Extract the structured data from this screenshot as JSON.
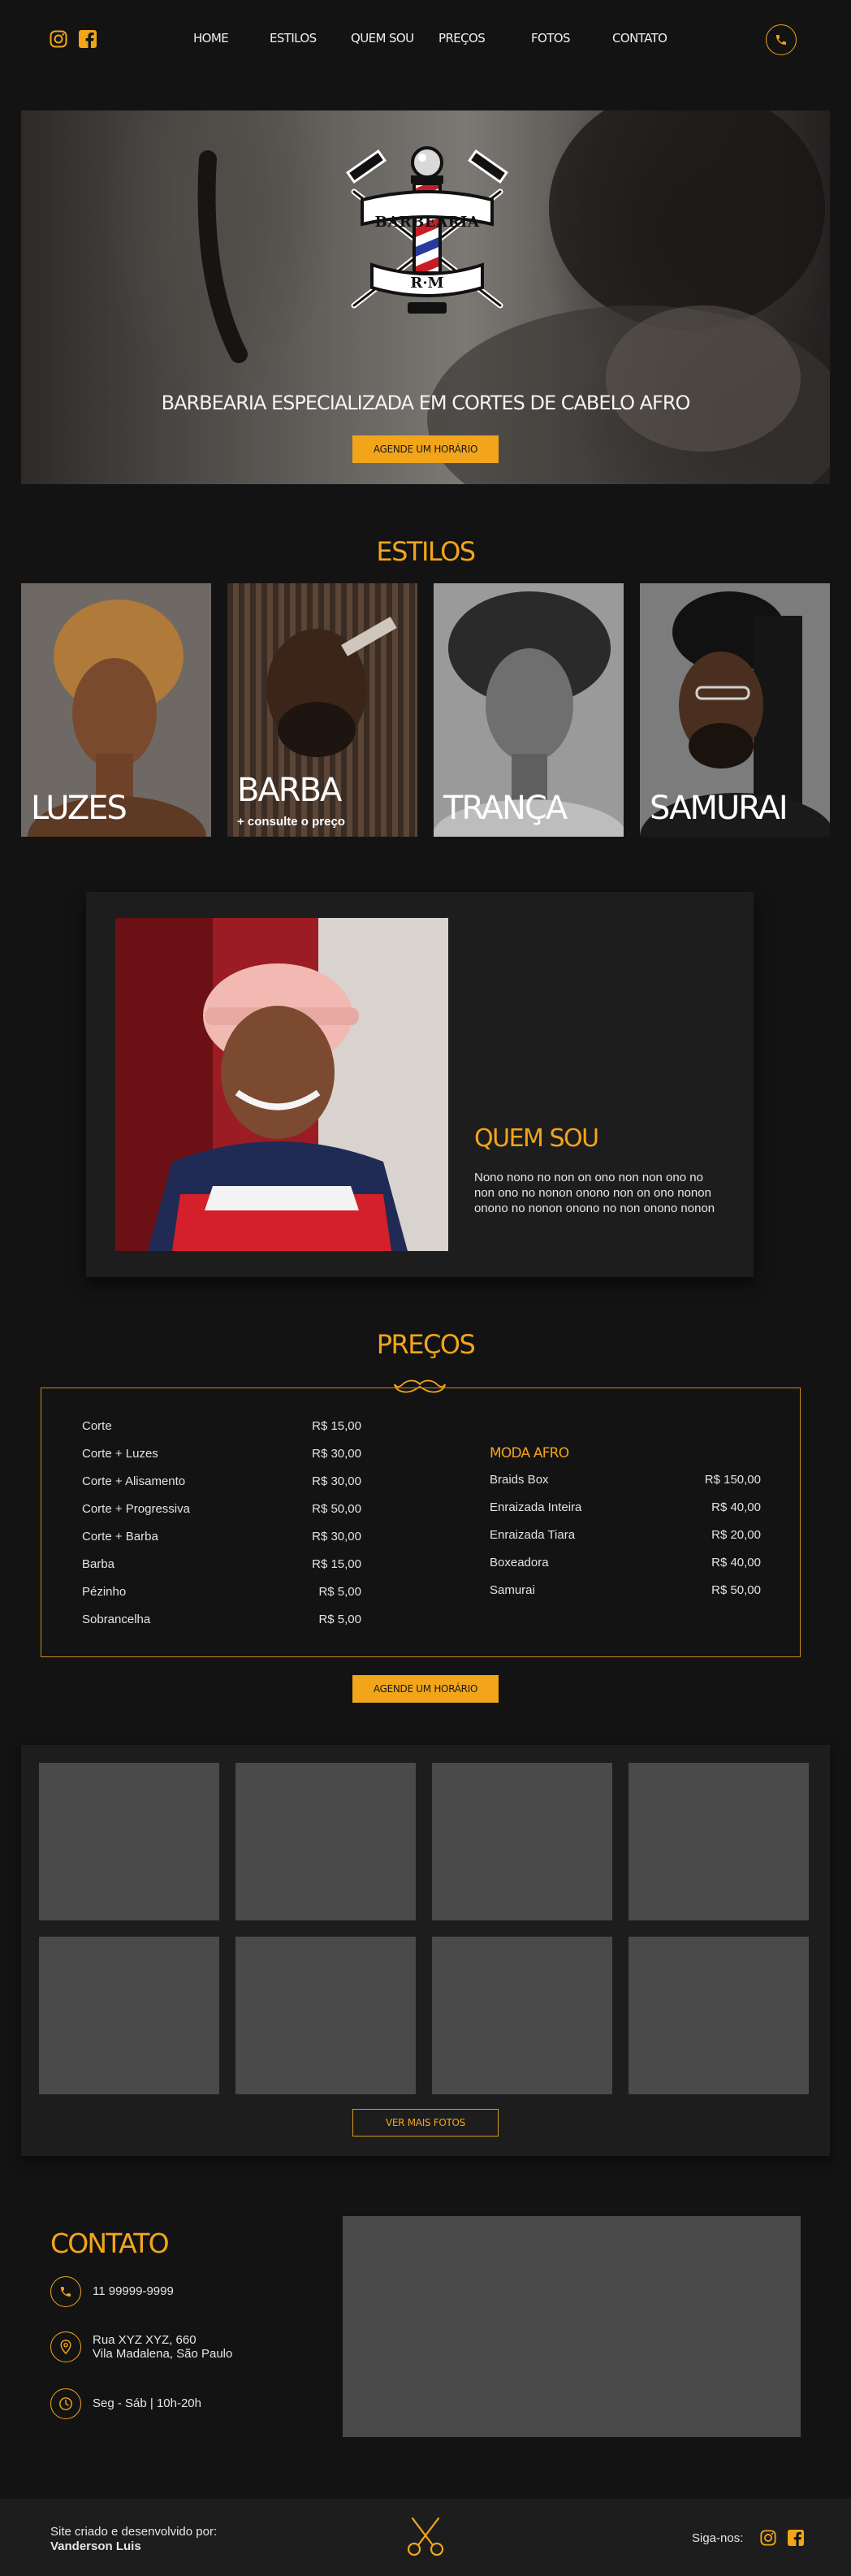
{
  "nav": {
    "items": [
      {
        "label": "HOME"
      },
      {
        "label": "ESTILOS"
      },
      {
        "label": "QUEM SOU"
      },
      {
        "label": "PREÇOS"
      },
      {
        "label": "FOTOS"
      },
      {
        "label": "CONTATO"
      }
    ],
    "social_icons": [
      "instagram-icon",
      "facebook-icon"
    ],
    "phone_icon": "phone-icon"
  },
  "hero": {
    "logo_text_top": "BARBEARIA",
    "logo_text_bottom": "R·M",
    "tagline": "BARBEARIA ESPECIALIZADA EM CORTES DE CABELO AFRO",
    "cta_label": "AGENDE UM HORÁRIO"
  },
  "estilos": {
    "title": "ESTILOS",
    "cards": [
      {
        "label": "LUZES",
        "sub": ""
      },
      {
        "label": "BARBA",
        "sub": "+ consulte o preço"
      },
      {
        "label": "TRANÇA",
        "sub": ""
      },
      {
        "label": "SAMURAI",
        "sub": ""
      }
    ]
  },
  "about": {
    "title": "QUEM SOU",
    "text": "Nono nono no non on ono non non ono no non ono no nonon onono non on ono nonon onono no nonon onono no non onono nonon"
  },
  "precos": {
    "title": "PREÇOS",
    "left": [
      {
        "name": "Corte",
        "price": "R$ 15,00"
      },
      {
        "name": "Corte + Luzes",
        "price": "R$ 30,00"
      },
      {
        "name": "Corte + Alisamento",
        "price": "R$ 30,00"
      },
      {
        "name": "Corte + Progressiva",
        "price": "R$ 50,00"
      },
      {
        "name": "Corte + Barba",
        "price": "R$ 30,00"
      },
      {
        "name": "Barba",
        "price": "R$ 15,00"
      },
      {
        "name": "Pézinho",
        "price": "R$ 5,00"
      },
      {
        "name": "Sobrancelha",
        "price": "R$ 5,00"
      }
    ],
    "right_title": "MODA AFRO",
    "right": [
      {
        "name": "Braids Box",
        "price": "R$ 150,00"
      },
      {
        "name": "Enraizada Inteira",
        "price": "R$ 40,00"
      },
      {
        "name": "Enraizada Tiara",
        "price": "R$ 20,00"
      },
      {
        "name": "Boxeadora",
        "price": "R$ 40,00"
      },
      {
        "name": "Samurai",
        "price": "R$ 50,00"
      }
    ],
    "cta_label": "AGENDE UM HORÁRIO"
  },
  "fotos": {
    "more_label": "VER MAIS FOTOS"
  },
  "contato": {
    "title": "CONTATO",
    "phone": "11  99999-9999",
    "address_line1": "Rua XYZ XYZ, 660",
    "address_line2": "Vila Madalena, São Paulo",
    "hours": "Seg - Sáb | 10h-20h"
  },
  "footer": {
    "credit_line1": "Site criado e desenvolvido por:",
    "credit_line2": "Vanderson Luis",
    "follow_label": "Siga-nos:"
  },
  "colors": {
    "accent": "#f2a51a",
    "background": "#131313",
    "panel": "#1d1d1d",
    "placeholder": "#4a4a4a"
  }
}
